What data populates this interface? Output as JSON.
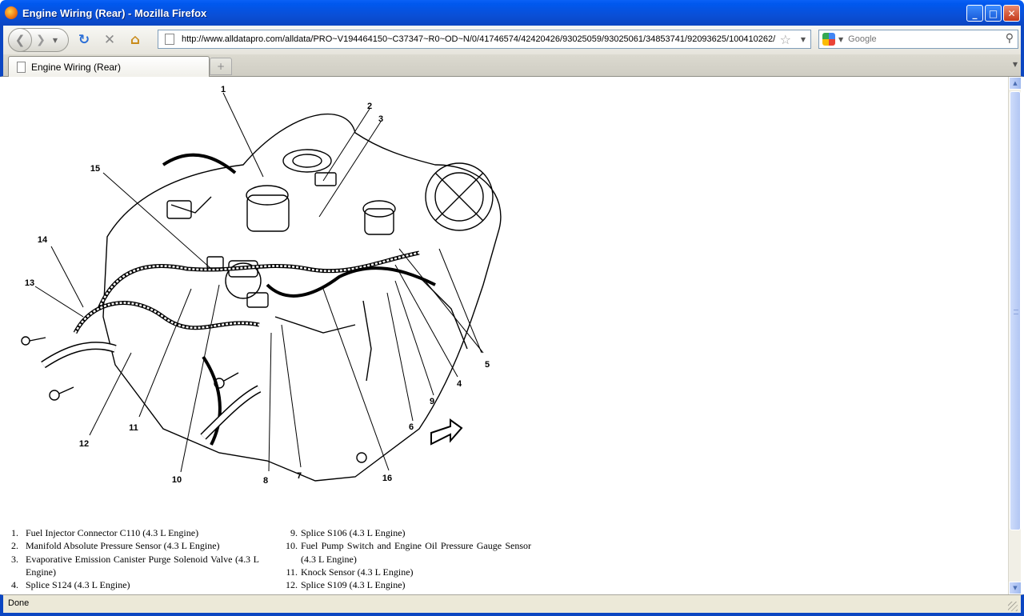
{
  "window": {
    "title": "Engine Wiring (Rear) - Mozilla Firefox",
    "controls": {
      "minimize": "_",
      "maximize": "□",
      "close": "✕"
    }
  },
  "toolbar": {
    "url": "http://www.alldatapro.com/alldata/PRO~V194464150~C37347~R0~OD~N/0/41746574/42420426/93025059/93025061/34853741/92093625/100410262/",
    "search_placeholder": "Google",
    "icons": [
      "back-icon",
      "forward-icon",
      "history-dropdown-icon",
      "reload-icon",
      "stop-icon",
      "home-icon",
      "page-icon",
      "bookmark-star-icon",
      "google-icon",
      "search-icon"
    ]
  },
  "tabs": [
    {
      "label": "Engine Wiring (Rear)",
      "active": true
    }
  ],
  "diagram": {
    "callouts": [
      "1",
      "2",
      "3",
      "4",
      "5",
      "6",
      "7",
      "8",
      "9",
      "10",
      "11",
      "12",
      "13",
      "14",
      "15",
      "16"
    ]
  },
  "legend": {
    "left": [
      {
        "num": "1.",
        "text": "Fuel Injector Connector C110 (4.3 L Engine)"
      },
      {
        "num": "2.",
        "text": "Manifold Absolute Pressure Sensor (4.3 L Engine)"
      },
      {
        "num": "3.",
        "text": "Evaporative Emission Canister Purge Solenoid Valve (4.3 L Engine)"
      },
      {
        "num": "4.",
        "text": "Splice S124 (4.3 L Engine)"
      }
    ],
    "right": [
      {
        "num": "9.",
        "text": "Splice S106 (4.3 L Engine)"
      },
      {
        "num": "10.",
        "text": "Fuel Pump Switch and Engine Oil Pressure Gauge Sensor (4.3 L Engine)"
      },
      {
        "num": "11.",
        "text": "Knock Sensor (4.3 L Engine)"
      },
      {
        "num": "12.",
        "text": "Splice S109 (4.3 L Engine)"
      }
    ]
  },
  "status": {
    "text": "Done"
  },
  "colors": {
    "titlebar": "#0058ee",
    "chrome": "#ece9d8"
  }
}
